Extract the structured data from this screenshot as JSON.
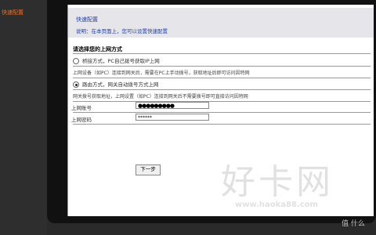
{
  "sidebar": {
    "items": [
      {
        "label": "快速配置"
      }
    ]
  },
  "header": {
    "title": "快速配置",
    "description": "说明：在本页面上，您可以设置快速配置"
  },
  "section": {
    "title": "请选择您的上网方式"
  },
  "options": [
    {
      "label": "桥接方式，PC自己拨号获取IP上网",
      "selected": false,
      "description": "上网设备（如PC）连接到网关后，需要在PC上手动拨号，获取地址后即可访问因特网"
    },
    {
      "label": "路由方式，网关自动拨号方式上网",
      "selected": true,
      "description": "网关拨号获取地址，上网设置（如PC）连接到网关后不需要拨号即可直接访问因特网"
    }
  ],
  "form": {
    "account_label": "上网账号",
    "account_value": "●●●●●●●●●",
    "password_label": "上网密码",
    "password_value": "******"
  },
  "buttons": {
    "next": "下一步"
  },
  "watermark": {
    "big": "好卡网",
    "url": "www.haoka88.com",
    "corner": "值 什么"
  }
}
